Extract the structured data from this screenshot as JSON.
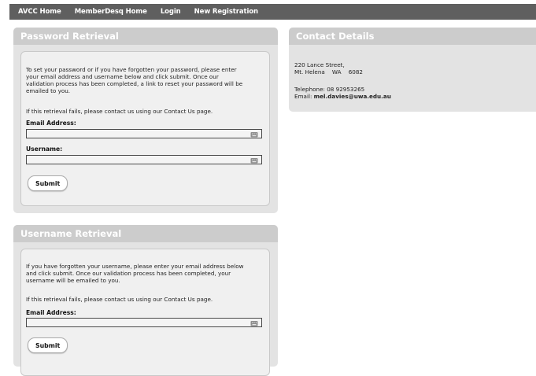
{
  "nav": {
    "items": [
      "AVCC Home",
      "MemberDesq Home",
      "Login",
      "New Registration"
    ]
  },
  "password_retrieval": {
    "title": "Password Retrieval",
    "intro_lines": [
      "To set your password or if you have forgotten your password, please enter",
      "your email address and username below and click submit. Once our",
      "validation process has been completed, a link to reset your password will be",
      "emailed to you."
    ],
    "fail_note": "If this retrieval fails, please contact us using our Contact Us page.",
    "email_label": "Email Address:",
    "email_value": "",
    "username_label": "Username:",
    "username_value": "",
    "submit_label": "Submit"
  },
  "username_retrieval": {
    "title": "Username Retrieval",
    "intro_lines": [
      "If you have forgotten your username, please enter your email address below",
      "and click submit. Once our validation process has been completed, your",
      "username will be emailed to you."
    ],
    "fail_note": "If this retrieval fails, please contact us using our Contact Us page.",
    "email_label": "Email Address:",
    "email_value": "",
    "submit_label": "Submit"
  },
  "contact": {
    "title": "Contact Details",
    "address_line1": "220 Lance Street,",
    "address_line2": "Mt. Helena    WA    6082",
    "telephone": "Telephone: 08 92953265",
    "email_prefix": "Email: ",
    "email": "mel.davies@uwa.edu.au"
  },
  "colors": {
    "nav_bg": "#5f5f5f",
    "panel_bg": "#e3e3e3",
    "panel_header": "#cccccc",
    "inner_bg": "#f0f0f0"
  },
  "icons": {
    "field_icon": "keyboard-icon"
  }
}
